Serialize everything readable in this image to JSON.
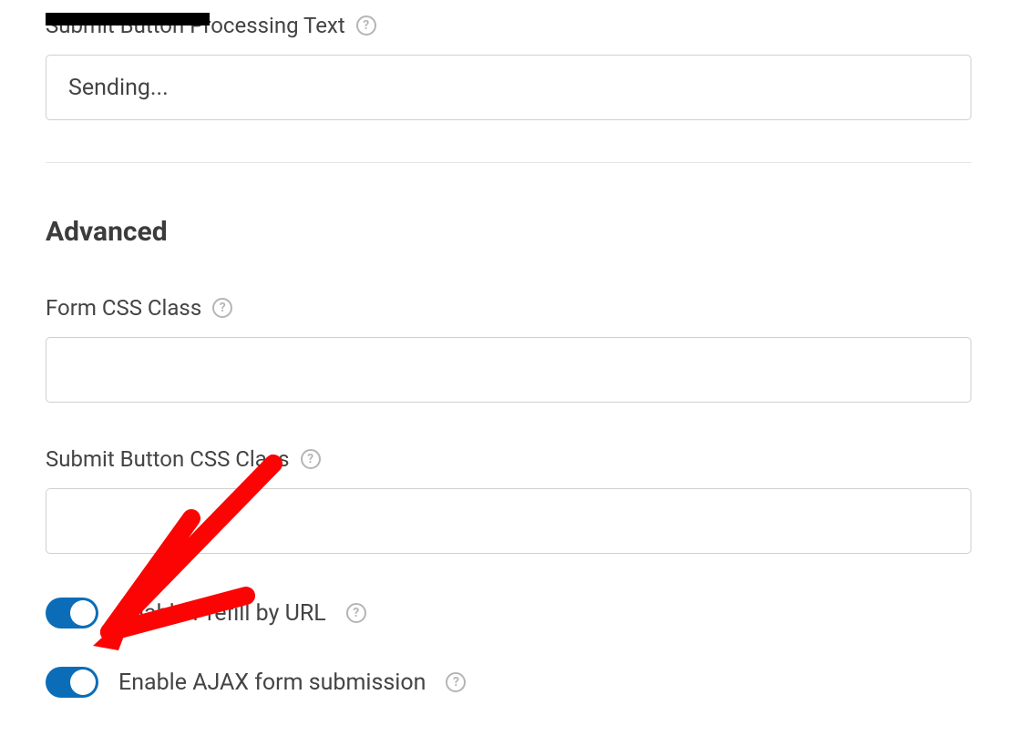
{
  "fields": {
    "processing_text": {
      "label": "Submit Button Processing Text",
      "value": "Sending..."
    },
    "form_css": {
      "label": "Form CSS Class",
      "value": ""
    },
    "submit_css": {
      "label": "Submit Button CSS Class",
      "value": ""
    }
  },
  "section": {
    "advanced": "Advanced"
  },
  "toggles": {
    "prefill": {
      "label": "Enable Prefill by URL",
      "on": true
    },
    "ajax": {
      "label": "Enable AJAX form submission",
      "on": true
    }
  }
}
